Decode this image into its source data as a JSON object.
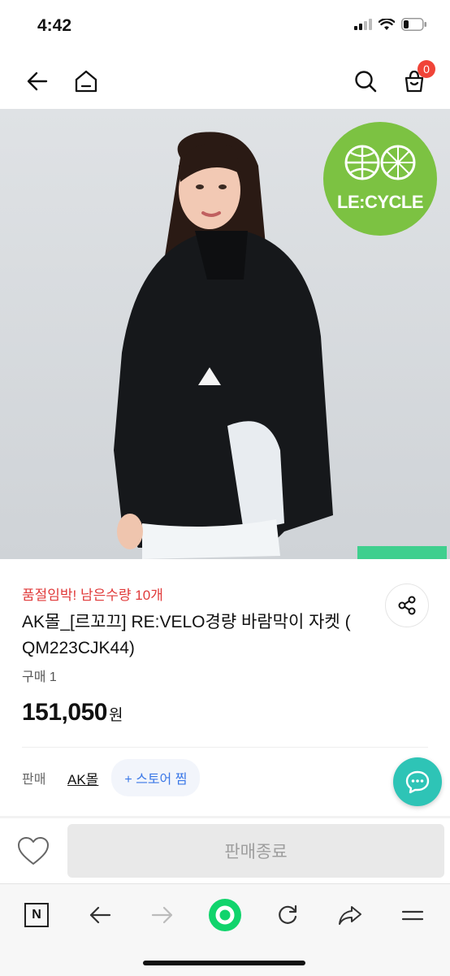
{
  "status_bar": {
    "time": "4:42"
  },
  "cart": {
    "count": "0"
  },
  "hero": {
    "badge_text": "LE:CYCLE"
  },
  "product": {
    "alert": "품절임박! 남은수량 10개",
    "title": "AK몰_[르꼬끄] RE:VELO경량 바람막이 자켓 ( QM223CJK44)",
    "purchase_count": "구매 1",
    "price": "151,050",
    "currency": "원"
  },
  "seller": {
    "label": "판매",
    "store_name": "AK몰",
    "follow_button": "+ 스토어 찜"
  },
  "action": {
    "sold_out_label": "판매종료"
  },
  "browser_bar": {
    "logo": "N"
  },
  "colors": {
    "alert": "#e03a3a",
    "accent": "#3b78e7",
    "chat": "#2ec4b6",
    "badge": "#f04438",
    "eco": "#7cc242"
  }
}
